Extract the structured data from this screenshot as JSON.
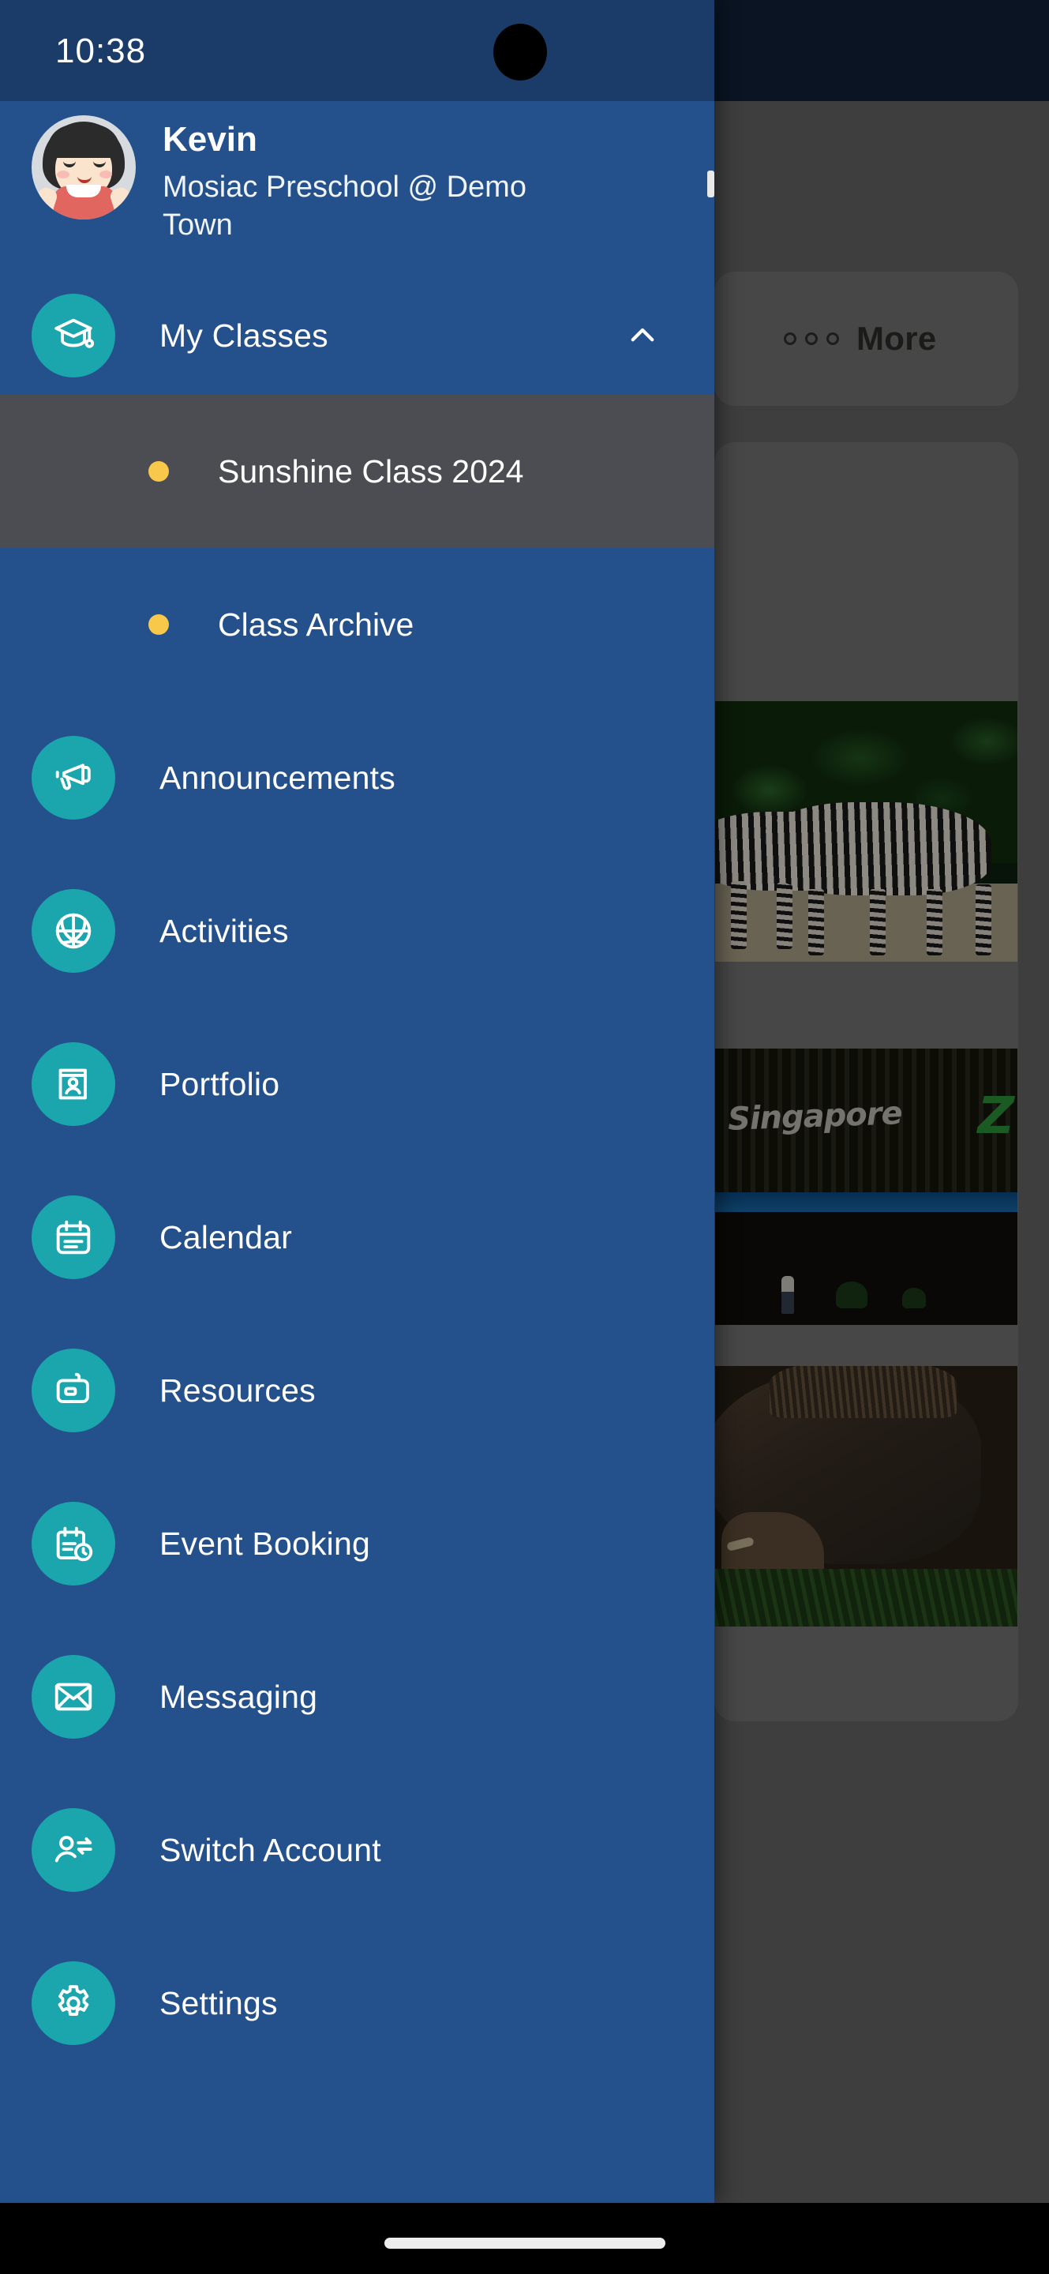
{
  "status_bar": {
    "time": "10:38",
    "wifi_icon": "wifi-icon",
    "signal_icon": "cellular-signal-icon"
  },
  "profile": {
    "name": "Kevin",
    "school": "Mosiac Preschool @ Demo Town",
    "avatar_icon": "avatar"
  },
  "drawer": {
    "sections": [
      {
        "label": "My Classes",
        "icon": "graduation-cap-icon",
        "expanded": true,
        "chevron_icon": "chevron-up-icon"
      }
    ],
    "classes": [
      {
        "label": "Sunshine Class 2024",
        "bullet_color": "#f8c84b",
        "active": true
      },
      {
        "label": "Class Archive",
        "bullet_color": "#f8c84b",
        "active": false
      }
    ],
    "nav_items": [
      {
        "label": "Announcements",
        "icon": "megaphone-icon"
      },
      {
        "label": "Activities",
        "icon": "basketball-icon"
      },
      {
        "label": "Portfolio",
        "icon": "portfolio-book-icon"
      },
      {
        "label": "Calendar",
        "icon": "calendar-icon"
      },
      {
        "label": "Resources",
        "icon": "resources-folder-icon"
      },
      {
        "label": "Event Booking",
        "icon": "calendar-clock-icon"
      },
      {
        "label": "Messaging",
        "icon": "envelope-icon"
      },
      {
        "label": "Switch Account",
        "icon": "switch-account-icon"
      },
      {
        "label": "Settings",
        "icon": "gear-icon"
      }
    ],
    "colors": {
      "background": "#24508c",
      "status_bar": "#1b3c68",
      "icon_circle": "#1ba5ac",
      "active_row": "#4b4d52",
      "bullet": "#f8c84b"
    }
  },
  "background_app": {
    "more_button_label": "More",
    "more_button_icon": "three-dots-icon",
    "photos": [
      {
        "name": "zebras-photo",
        "alt": "Two zebras standing in front of green foliage"
      },
      {
        "name": "singapore-zoo-sign-photo",
        "alt": "Singapore Zoo entrance sign",
        "sign_text": "Singapore",
        "sign_letter": "Z"
      },
      {
        "name": "warthog-photo",
        "alt": "Warthog grazing in grass"
      }
    ]
  },
  "system": {
    "gesture_bar": "home-gesture-bar"
  }
}
